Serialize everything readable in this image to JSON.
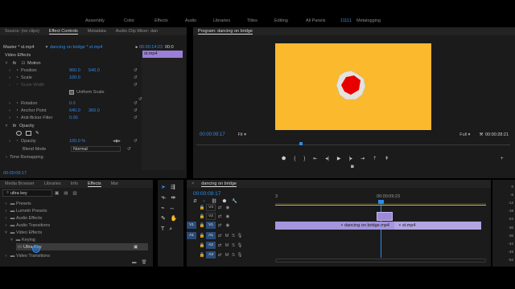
{
  "workspace_tabs": [
    "Assembly",
    "Color",
    "Effects",
    "Audio",
    "Libraries",
    "Titles",
    "Editing",
    "All Panels",
    "11111",
    "Metalogging"
  ],
  "source_panel": {
    "tabs": [
      "Source: (no clips)",
      "Effect Controls",
      "Metadata",
      "Audio Clip Mixer: dan"
    ],
    "master_label": "Master * st.mp4",
    "clip_label": "dancing on bridge * st.mp4",
    "timecodes": [
      "00:00:14:23",
      "00:0"
    ],
    "clip_chip": "st.mp4",
    "section_video": "Video Effects",
    "motion": "Motion",
    "position": {
      "label": "Position",
      "x": "960.0",
      "y": "540.0"
    },
    "scale": {
      "label": "Scale",
      "value": "100.0"
    },
    "scale_width": {
      "label": "Scale Width"
    },
    "uniform_scale": "Uniform Scale",
    "rotation": {
      "label": "Rotation",
      "value": "0.0"
    },
    "anchor": {
      "label": "Anchor Point",
      "x": "640.0",
      "y": "360.0"
    },
    "antiflicker": {
      "label": "Anti-flicker Filter",
      "value": "0.00"
    },
    "opacity_group": "Opacity",
    "opacity": {
      "label": "Opacity",
      "value": "100.0 %"
    },
    "blend": {
      "label": "Blend Mode",
      "value": "Normal"
    },
    "time_remap": "Time Remapping",
    "bottom_timecode": "00:00:09:17"
  },
  "program_panel": {
    "title": "Program: dancing on bridge",
    "timecode": "00:00:09:17",
    "fit": "Fit",
    "quality": "Full",
    "duration": "00:00:28:21",
    "canvas_color": "#fbb92e",
    "shape_color": "#e80000"
  },
  "effects_panel": {
    "tabs": [
      "Media Browser",
      "Libraries",
      "Info",
      "Effects",
      "Mar"
    ],
    "search_value": "ultra key",
    "tree": [
      {
        "label": "Presets",
        "level": 0
      },
      {
        "label": "Lumetri Presets",
        "level": 0
      },
      {
        "label": "Audio Effects",
        "level": 0
      },
      {
        "label": "Audio Transitions",
        "level": 0
      },
      {
        "label": "Video Effects",
        "level": 0
      },
      {
        "label": "Keying",
        "level": 1
      },
      {
        "label": "Ultra Key",
        "level": 2
      },
      {
        "label": "Video Transitions",
        "level": 0
      }
    ]
  },
  "timeline": {
    "tab": "dancing on bridge",
    "timecode": "00:00:09:17",
    "ruler_left": "3",
    "ruler_right": "00:00:09:23",
    "tracks_video": [
      "V3",
      "V2",
      "V1"
    ],
    "tracks_audio": [
      "A1",
      "A2",
      "A3"
    ],
    "src_v": "V1",
    "src_a": "A1",
    "clip1": "dancing on bridge.mp4",
    "clip2": "st.mp4"
  },
  "meter_labels": [
    "0",
    "-6",
    "-12",
    "-18",
    "-24",
    "-30",
    "-36",
    "-42",
    "-48",
    "-54"
  ]
}
